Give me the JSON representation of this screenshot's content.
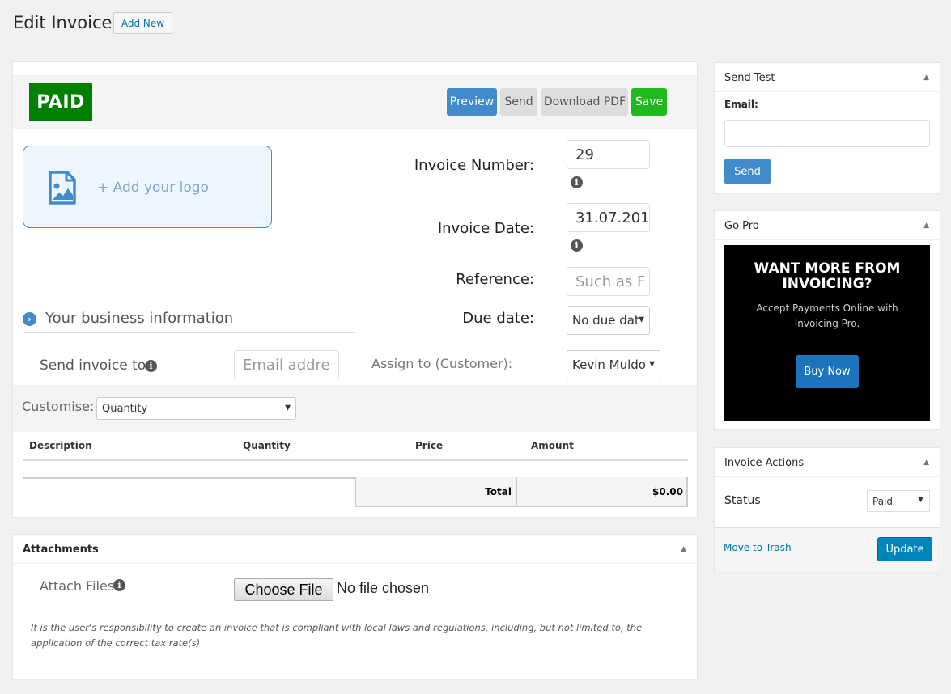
{
  "page": {
    "title": "Edit Invoice",
    "add_new_label": "Add New"
  },
  "invoice_header": {
    "status_stamp": "PAID",
    "status_stamp_color": "#008000",
    "buttons": {
      "preview": "Preview",
      "send": "Send",
      "download_pdf": "Download PDF",
      "save": "Save"
    }
  },
  "logo": {
    "add_logo_label": "+ Add your logo",
    "icon": "image-file-icon"
  },
  "fields": {
    "invoice_number": {
      "label": "Invoice Number:",
      "value": "29"
    },
    "invoice_date": {
      "label": "Invoice Date:",
      "value": "31.07.201"
    },
    "reference": {
      "label": "Reference:",
      "placeholder": "Such as F"
    },
    "due_date": {
      "label": "Due date:",
      "selected": "No due dat"
    },
    "send_invoice_to": {
      "label": "Send invoice to:",
      "placeholder": "Email addre"
    },
    "assign_to": {
      "label": "Assign to (Customer):",
      "selected": "Kevin Muldo"
    }
  },
  "business_info": {
    "label": "Your business information"
  },
  "customise": {
    "label": "Customise:",
    "selected": "Quantity"
  },
  "items_table": {
    "columns": [
      "Description",
      "Quantity",
      "Price",
      "Amount"
    ],
    "rows": [],
    "total_label": "Total",
    "total_value": "$0.00"
  },
  "attachments": {
    "title": "Attachments",
    "attach_label": "Attach Files",
    "choose_file_label": "Choose File",
    "no_file_text": "No file chosen",
    "disclaimer": "It is the user's responsibility to create an invoice that is compliant with local laws and regulations, including, but not limited to, the application of the correct tax rate(s)"
  },
  "sidebar": {
    "send_test": {
      "title": "Send Test",
      "email_label": "Email:",
      "email_value": "",
      "send_label": "Send"
    },
    "go_pro": {
      "title": "Go Pro",
      "headline": "WANT MORE FROM INVOICING?",
      "subtext": "Accept Payments Online with Invoicing Pro.",
      "buy_now_label": "Buy Now"
    },
    "invoice_actions": {
      "title": "Invoice Actions",
      "status_label": "Status",
      "status_selected": "Paid",
      "trash_label": "Move to Trash",
      "update_label": "Update"
    }
  },
  "colors": {
    "primary_blue": "#428bca",
    "save_green": "#1db91d",
    "wp_update_blue": "#0085ba",
    "buy_now_blue": "#1e73be"
  }
}
